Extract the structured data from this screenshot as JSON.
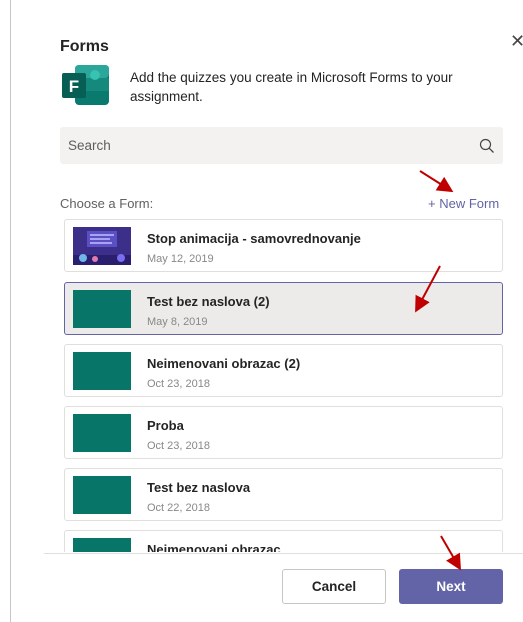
{
  "dialog": {
    "title": "Forms",
    "close_icon": "close-icon",
    "description": "Add the quizzes you create in Microsoft Forms to your assignment."
  },
  "search": {
    "placeholder": "Search",
    "icon": "search-icon"
  },
  "choose_label": "Choose a Form:",
  "new_form_label": "+ New Form",
  "forms": [
    {
      "name": "Stop animacija - samovrednovanje",
      "date": "May 12, 2019",
      "thumb": "purple"
    },
    {
      "name": "Test bez naslova (2)",
      "date": "May 8, 2019",
      "thumb": "teal",
      "selected": true
    },
    {
      "name": "Neimenovani obrazac (2)",
      "date": "Oct 23, 2018",
      "thumb": "teal"
    },
    {
      "name": "Proba",
      "date": "Oct 23, 2018",
      "thumb": "teal"
    },
    {
      "name": "Test bez naslova",
      "date": "Oct 22, 2018",
      "thumb": "teal"
    },
    {
      "name": "Neimenovani obrazac",
      "date": "",
      "thumb": "teal"
    }
  ],
  "footer": {
    "cancel_label": "Cancel",
    "next_label": "Next"
  },
  "colors": {
    "accent": "#6264a7",
    "forms_green": "#077568",
    "arrow": "#c00000"
  }
}
